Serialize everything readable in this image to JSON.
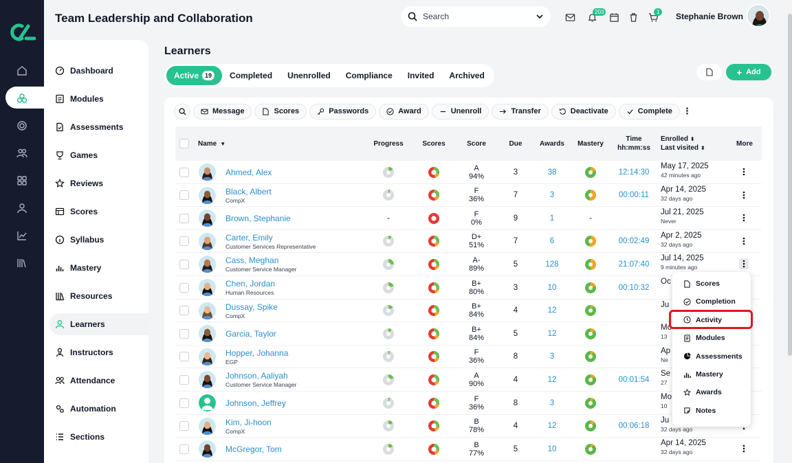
{
  "app": {
    "title": "Team Leadership and Collaboration"
  },
  "search": {
    "placeholder": "Search"
  },
  "header": {
    "notifications_count": "203",
    "cart_count": "1",
    "user_name": "Stephanie Brown"
  },
  "nav": {
    "items": [
      "Dashboard",
      "Modules",
      "Assessments",
      "Games",
      "Reviews",
      "Scores",
      "Syllabus",
      "Mastery",
      "Resources",
      "Learners",
      "Instructors",
      "Attendance",
      "Automation",
      "Sections"
    ],
    "active": "Learners"
  },
  "page": {
    "title": "Learners",
    "add_label": "Add"
  },
  "tabs": [
    {
      "label": "Active",
      "count": "19"
    },
    {
      "label": "Completed"
    },
    {
      "label": "Unenrolled"
    },
    {
      "label": "Compliance"
    },
    {
      "label": "Invited"
    },
    {
      "label": "Archived"
    }
  ],
  "toolbar": [
    "Message",
    "Scores",
    "Passwords",
    "Award",
    "Unenroll",
    "Transfer",
    "Deactivate",
    "Complete"
  ],
  "columns": {
    "name": "Name",
    "progress": "Progress",
    "scores": "Scores",
    "score": "Score",
    "due": "Due",
    "awards": "Awards",
    "mastery": "Mastery",
    "time": "Time",
    "time_fmt": "hh:mm:ss",
    "enrolled": "Enrolled",
    "last_visited": "Last visited",
    "more": "More"
  },
  "learners": [
    {
      "name": "Ahmed, Alex",
      "org": "",
      "progress": 0.15,
      "grade": "A",
      "pct": "94%",
      "due": "3",
      "awards": "38",
      "mastery": 0.2,
      "time": "12:14:30",
      "enrolled": "May 17, 2025",
      "ago": "42 minutes ago",
      "skin": "#c68e6a",
      "hair": "#2b1d16"
    },
    {
      "name": "Black, Albert",
      "org": "CompX",
      "progress": 0.05,
      "grade": "F",
      "pct": "36%",
      "due": "7",
      "awards": "3",
      "mastery": 0.55,
      "time": "00:00:11",
      "enrolled": "Apr 14, 2025",
      "ago": "32 days ago",
      "skin": "#8a5a3c",
      "hair": "#1b120c"
    },
    {
      "name": "Brown, Stephanie",
      "org": "",
      "progress": null,
      "grade": "F",
      "pct": "0%",
      "due": "9",
      "awards": "1",
      "mastery": null,
      "time": "",
      "enrolled": "Jul 21, 2025",
      "ago": "Never",
      "skin": "#6d4530",
      "hair": "#20140f"
    },
    {
      "name": "Carter, Emily",
      "org": "Customer Services Representative",
      "progress": 0.1,
      "grade": "D+",
      "pct": "51%",
      "due": "7",
      "awards": "6",
      "mastery": 0.55,
      "time": "00:02:49",
      "enrolled": "Apr 2, 2025",
      "ago": "32 days ago",
      "skin": "#d9a27c",
      "hair": "#5a3522"
    },
    {
      "name": "Cass, Meghan",
      "org": "Customer Service Manager",
      "progress": 0.25,
      "grade": "A-",
      "pct": "89%",
      "due": "5",
      "awards": "128",
      "mastery": 0.5,
      "time": "21:07:40",
      "enrolled": "Jul 14, 2025",
      "ago": "9 minutes ago",
      "skin": "#b07855",
      "hair": "#2a1a12"
    },
    {
      "name": "Chen, Jordan",
      "org": "Human Resources",
      "progress": 0.2,
      "grade": "B+",
      "pct": "80%",
      "due": "3",
      "awards": "10",
      "mastery": 0.2,
      "time": "00:10:32",
      "enrolled": "Oc",
      "ago": "",
      "skin": "#e0b08c",
      "hair": "#1a1110"
    },
    {
      "name": "Dussay, Spike",
      "org": "CompX",
      "progress": 0.15,
      "grade": "B+",
      "pct": "84%",
      "due": "4",
      "awards": "12",
      "mastery": 0.1,
      "time": "",
      "enrolled": "Ju",
      "ago": "",
      "skin": "#e6b996",
      "hair": "#7a4a2a"
    },
    {
      "name": "Garcia, Taylor",
      "org": "",
      "progress": 0.1,
      "grade": "B+",
      "pct": "84%",
      "due": "5",
      "awards": "12",
      "mastery": 0.15,
      "time": "",
      "enrolled": "Mo",
      "ago": "13",
      "skin": "#8a5a3c",
      "hair": "#1b120c"
    },
    {
      "name": "Hopper, Johanna",
      "org": "EGP",
      "progress": 0.05,
      "grade": "F",
      "pct": "36%",
      "due": "8",
      "awards": "3",
      "mastery": 0.1,
      "time": "",
      "enrolled": "Ap",
      "ago": "Ne",
      "skin": "#e8b895",
      "hair": "#3a2518"
    },
    {
      "name": "Johnson, Aaliyah",
      "org": "Customer Service Manager",
      "progress": 0.2,
      "grade": "A",
      "pct": "90%",
      "due": "4",
      "awards": "12",
      "mastery": 0.15,
      "time": "00:01:54",
      "enrolled": "Se",
      "ago": "27",
      "skin": "#7a4a30",
      "hair": "#1b120c"
    },
    {
      "name": "Johnson, Jeffrey",
      "org": "",
      "progress": 0.05,
      "grade": "F",
      "pct": "36%",
      "due": "8",
      "awards": "3",
      "mastery": 0.1,
      "time": "",
      "enrolled": "Mo",
      "ago": "10",
      "skin": "#27c28f",
      "hair": "#27c28f"
    },
    {
      "name": "Kim, Ji-hoon",
      "org": "CompX",
      "progress": 0.15,
      "grade": "B",
      "pct": "78%",
      "due": "4",
      "awards": "12",
      "mastery": 0.15,
      "time": "00:06:18",
      "enrolled": "Ju",
      "ago": "32 days ago",
      "skin": "#e0b08c",
      "hair": "#1a1110"
    },
    {
      "name": "McGregor, Tom",
      "org": "",
      "progress": 0.15,
      "grade": "B",
      "pct": "77%",
      "due": "5",
      "awards": "10",
      "mastery": 0.1,
      "time": "",
      "enrolled": "Apr 14, 2025",
      "ago": "32 days ago",
      "skin": "#6d4530",
      "hair": "#1b120c"
    }
  ],
  "context_menu": {
    "items": [
      "Scores",
      "Completion",
      "Activity",
      "Modules",
      "Assessments",
      "Mastery",
      "Awards",
      "Notes"
    ],
    "highlighted": "Activity"
  },
  "colors": {
    "accent": "#27c28f",
    "link": "#2a8fd0",
    "rail": "#161b2e",
    "highlight": "#e0161b"
  }
}
